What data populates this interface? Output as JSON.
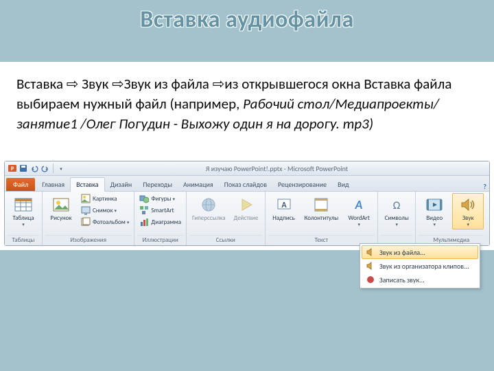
{
  "slide": {
    "title": "Вставка аудиофайла",
    "instruction_parts": {
      "p1": "Вставка ",
      "p2": " Звук ",
      "p3": "Звук из файла ",
      "p4": "из открывшегося окна Вставка файла  выбираем нужный файл (например, ",
      "italic": "Рабочий стол/Медиапроекты/занятие1 /Олег Погудин - Выхожу один я на дорогу. mp3)",
      "arrow": "⇨"
    }
  },
  "ribbon": {
    "window_title": "Я изучаю PowerPoint!.pptx - Microsoft PowerPoint",
    "tabs": {
      "file": "Файл",
      "home": "Главная",
      "insert": "Вставка",
      "design": "Дизайн",
      "transitions": "Переходы",
      "animations": "Анимация",
      "slideshow": "Показ слайдов",
      "review": "Рецензирование",
      "view": "Вид"
    },
    "groups": {
      "tables": {
        "label": "Таблицы",
        "table": "Таблица"
      },
      "images": {
        "label": "Изображения",
        "picture": "Рисунок",
        "clipart": "Картинка",
        "screenshot": "Снимок",
        "album": "Фотоальбом"
      },
      "illustrations": {
        "label": "Иллюстрации",
        "shapes": "Фигуры",
        "smartart": "SmartArt",
        "chart": "Диаграмма"
      },
      "links": {
        "label": "Ссылки",
        "hyperlink": "Гиперссылка",
        "action": "Действие"
      },
      "text": {
        "label": "Текст",
        "textbox": "Надпись",
        "headerfooter": "Колонтитулы",
        "wordart": "WordArt"
      },
      "symbols": {
        "label": "Символы"
      },
      "media": {
        "label": "Мультимедиа",
        "video": "Видео",
        "audio": "Звук"
      }
    },
    "audio_menu": {
      "from_file": "Звук из файла...",
      "from_organizer": "Звук из организатора клипов...",
      "record": "Записать звук..."
    }
  }
}
